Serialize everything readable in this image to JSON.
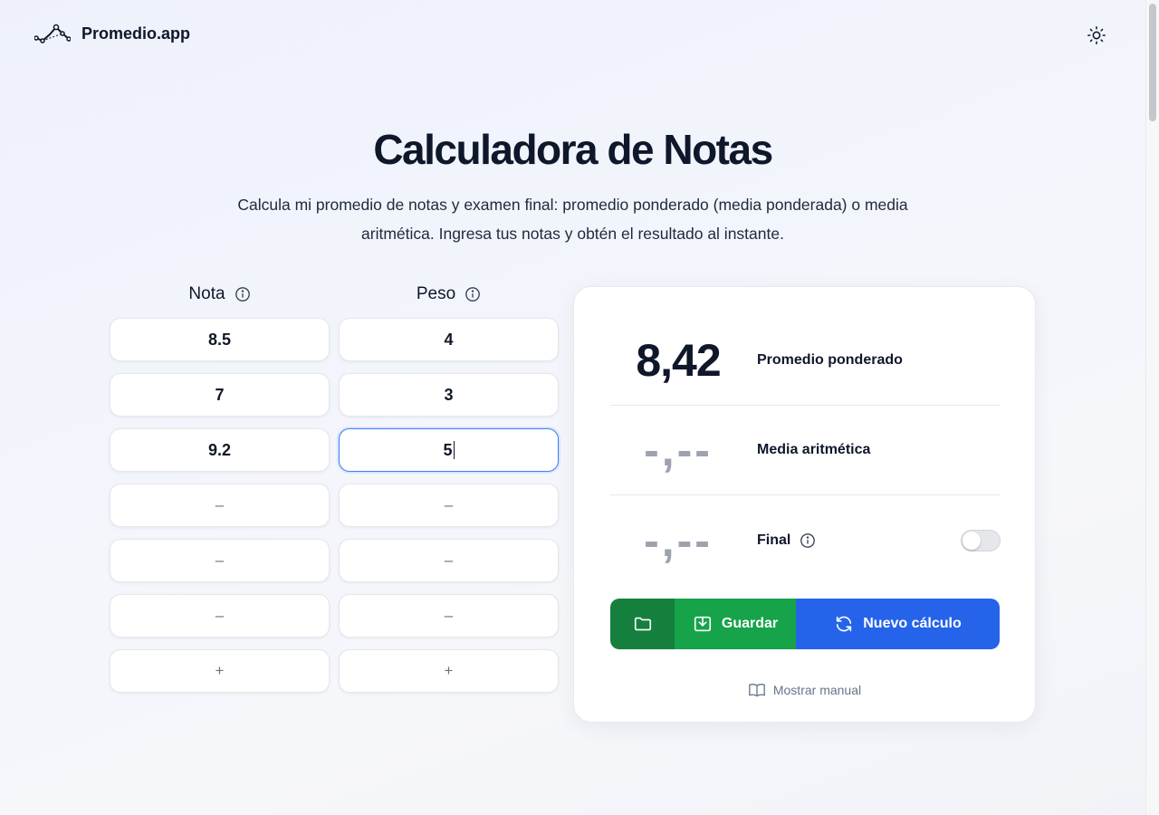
{
  "header": {
    "logo_text": "Promedio.app",
    "theme_icon": "sun-icon"
  },
  "hero": {
    "title": "Calculadora de Notas",
    "description": "Calcula mi promedio de notas y examen final: promedio ponderado (media ponderada) o media aritmética. Ingresa tus notas y obtén el resultado al instante."
  },
  "columns": {
    "nota_label": "Nota",
    "peso_label": "Peso"
  },
  "notas": [
    "8.5",
    "7",
    "9.2",
    "–",
    "–",
    "–"
  ],
  "pesos": [
    "4",
    "3",
    "5",
    "–",
    "–",
    "–"
  ],
  "add_label": "+",
  "results": {
    "weighted_value": "8,42",
    "weighted_label": "Promedio ponderado",
    "arith_value": "-,--",
    "arith_label": "Media aritmética",
    "final_value": "-,--",
    "final_label": "Final",
    "final_toggle_on": false
  },
  "actions": {
    "save_label": "Guardar",
    "new_label": "Nuevo cálculo"
  },
  "manual_label": "Mostrar manual",
  "colors": {
    "green_dark": "#15803d",
    "green": "#16a34a",
    "blue": "#2563eb",
    "focus": "#3b82f6"
  }
}
